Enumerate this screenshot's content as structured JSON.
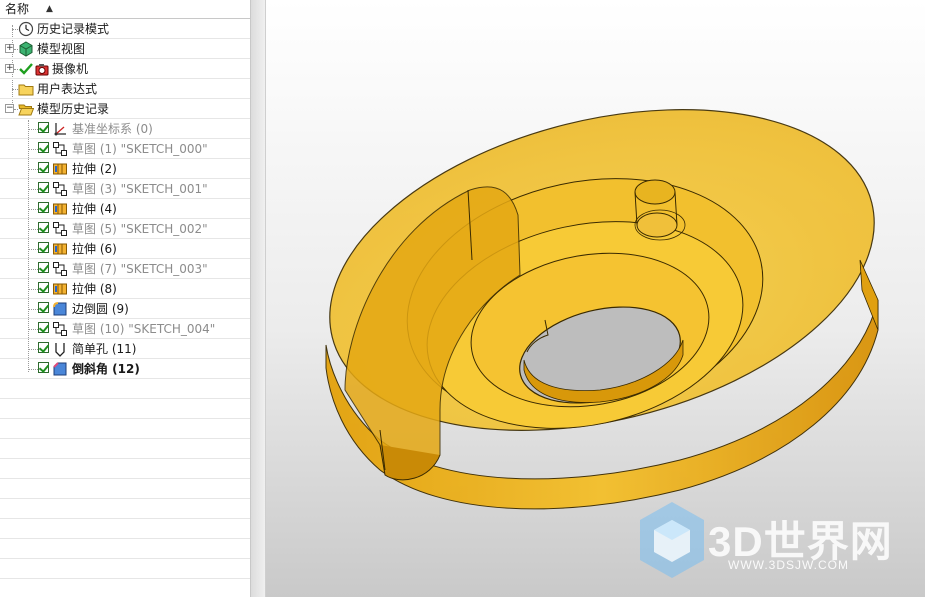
{
  "navigator": {
    "header_label": "名称",
    "items": [
      {
        "label": "历史记录模式",
        "icon": "clock-icon",
        "style": "normal"
      },
      {
        "label": "模型视图",
        "icon": "model-views-icon",
        "style": "normal"
      },
      {
        "label": "摄像机",
        "icon": "camera-icon",
        "style": "normal"
      },
      {
        "label": "用户表达式",
        "icon": "folder-icon",
        "style": "normal"
      },
      {
        "label": "模型历史记录",
        "icon": "folder-open-icon",
        "style": "normal"
      },
      {
        "label": "基准坐标系 (0)",
        "icon": "datum-csys-icon",
        "style": "grey"
      },
      {
        "label": "草图 (1) \"SKETCH_000\"",
        "icon": "sketch-icon",
        "style": "grey"
      },
      {
        "label": "拉伸 (2)",
        "icon": "extrude-icon",
        "style": "normal"
      },
      {
        "label": "草图 (3) \"SKETCH_001\"",
        "icon": "sketch-icon",
        "style": "grey"
      },
      {
        "label": "拉伸 (4)",
        "icon": "extrude-icon",
        "style": "normal"
      },
      {
        "label": "草图 (5) \"SKETCH_002\"",
        "icon": "sketch-icon",
        "style": "grey"
      },
      {
        "label": "拉伸 (6)",
        "icon": "extrude-icon",
        "style": "normal"
      },
      {
        "label": "草图 (7) \"SKETCH_003\"",
        "icon": "sketch-icon",
        "style": "grey"
      },
      {
        "label": "拉伸 (8)",
        "icon": "extrude-icon",
        "style": "normal"
      },
      {
        "label": "边倒圆 (9)",
        "icon": "edge-blend-icon",
        "style": "normal"
      },
      {
        "label": "草图 (10) \"SKETCH_004\"",
        "icon": "sketch-icon",
        "style": "grey"
      },
      {
        "label": "简单孔 (11)",
        "icon": "simple-hole-icon",
        "style": "normal"
      },
      {
        "label": "倒斜角 (12)",
        "icon": "chamfer-icon",
        "style": "bold"
      }
    ]
  },
  "watermark": {
    "title": "3D世界网",
    "url": "WWW.3DSJW.COM"
  },
  "colors": {
    "part_fill": "#f2c430",
    "part_edge": "#3a2a00",
    "accent_green": "#1f8f1f"
  }
}
